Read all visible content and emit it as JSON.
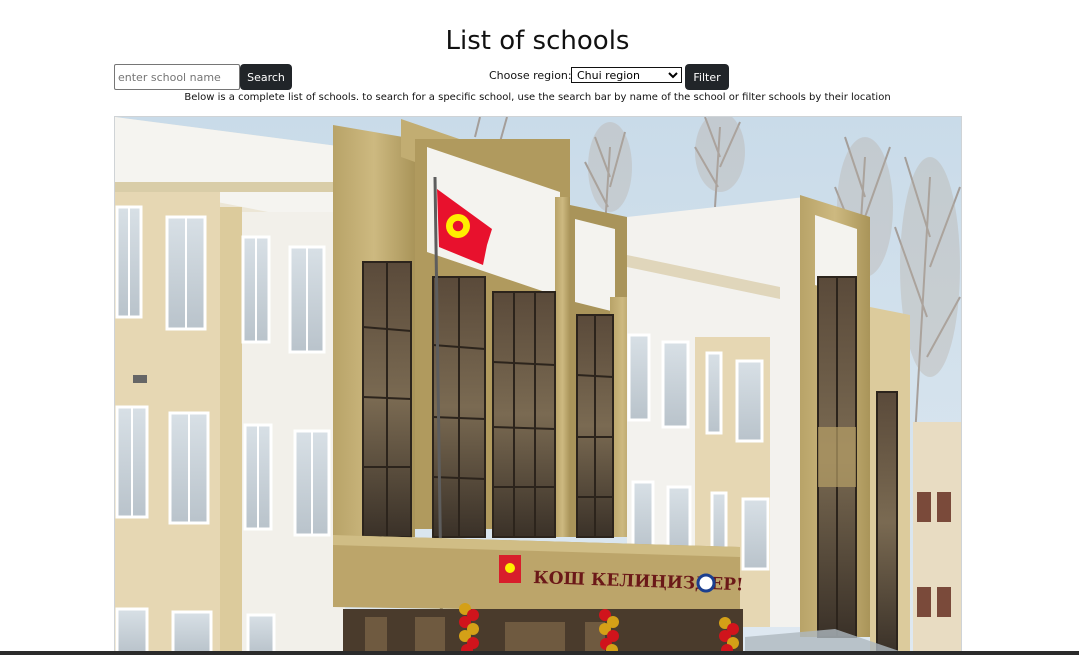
{
  "page": {
    "title": "List of schools",
    "description": "Below is a complete list of schools. to search for a specific school, use the search bar by name of the school or filter schools by their location"
  },
  "search": {
    "placeholder": "enter school name",
    "value": "",
    "button_label": "Search"
  },
  "filter": {
    "label": "Choose region:",
    "selected": "Chui region",
    "button_label": "Filter"
  },
  "photo": {
    "entrance_sign": "КОШ КЕЛИҢИЗДЕР!"
  },
  "colors": {
    "button_bg": "#212529",
    "button_text": "#ffffff",
    "flag_red": "#e8112d",
    "flag_yellow": "#ffef00"
  }
}
